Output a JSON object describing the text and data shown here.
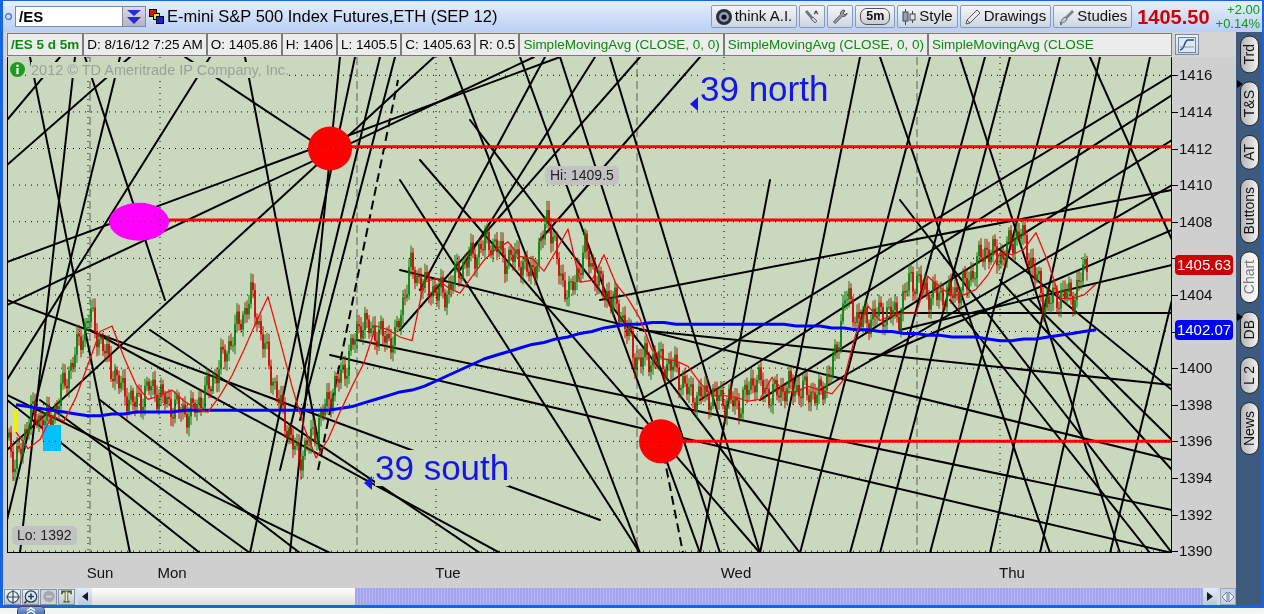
{
  "toolbar": {
    "symbol": "/ES",
    "description": "E-mini S&P 500 Index Futures,ETH (SEP 12)",
    "buttons": [
      {
        "kind": "ai",
        "label": "think A.I."
      },
      {
        "kind": "interval",
        "label": "5m"
      },
      {
        "kind": "style",
        "label": "Style"
      },
      {
        "kind": "drawings",
        "label": "Drawings"
      },
      {
        "kind": "studies",
        "label": "Studies"
      }
    ],
    "last_price": "1405.50",
    "net_change": "+2.00",
    "percent_change": "+0.14%"
  },
  "info_bar": [
    {
      "kind": "symbol",
      "text": "/ES 5 d 5m"
    },
    {
      "kind": "field",
      "text": "D: 8/16/12 7:25 AM"
    },
    {
      "kind": "field",
      "text": "O: 1405.86"
    },
    {
      "kind": "field",
      "text": "H: 1406"
    },
    {
      "kind": "field",
      "text": "L: 1405.5"
    },
    {
      "kind": "field",
      "text": "C: 1405.63"
    },
    {
      "kind": "field",
      "text": "R: 0.5"
    },
    {
      "kind": "study",
      "text": "SimpleMovingAvg (CLOSE, 0, 0)"
    },
    {
      "kind": "study",
      "text": "SimpleMovingAvg (CLOSE, 0, 0)"
    },
    {
      "kind": "study",
      "text": "SimpleMovingAvg (CLOSE"
    }
  ],
  "chart": {
    "copyright": "2012 © TD Ameritrade IP Company, Inc.",
    "annotations": [
      {
        "text": "39 north"
      },
      {
        "text": "39 south"
      }
    ],
    "hi_label": "Hi: 1409.5",
    "lo_label": "Lo: 1392",
    "price_tags": [
      {
        "text": "1405.63",
        "color": "#cc0000"
      },
      {
        "text": "1402.07",
        "color": "#0000ff"
      }
    ],
    "chart_data": {
      "type": "line",
      "grid": true,
      "categories": [
        null,
        null,
        null,
        null,
        null,
        null,
        null,
        "Sun",
        null,
        null,
        null,
        null,
        null,
        "Mon",
        null,
        null,
        null,
        null,
        null,
        null,
        null,
        null,
        null,
        null,
        null,
        null,
        null,
        null,
        null,
        null,
        null,
        null,
        null,
        null,
        null,
        null,
        "Tue",
        null,
        null,
        null,
        null,
        null,
        null,
        null,
        null,
        null,
        null,
        null,
        null,
        null,
        null,
        null,
        null,
        null,
        null,
        null,
        null,
        null,
        null,
        null,
        "Wed",
        null,
        null,
        null,
        null,
        null,
        null,
        null,
        null,
        null,
        null,
        null,
        null,
        null,
        null,
        null,
        null,
        null,
        null,
        null,
        null,
        null,
        null,
        "Thu",
        null,
        null,
        null,
        null,
        null,
        null,
        null,
        null,
        null,
        null,
        null,
        null,
        null,
        null
      ],
      "series": [
        {
          "color": "#0000ff",
          "values": [
            1398.0,
            1397.9,
            1397.8,
            1397.7,
            1397.6,
            1397.5,
            1397.4,
            1397.4,
            1397.5,
            1397.5,
            1397.6,
            1397.6,
            1397.6,
            1397.6,
            1397.7,
            1397.7,
            1397.7,
            1397.7,
            1397.7,
            1397.7,
            1397.7,
            1397.7,
            1397.7,
            1397.7,
            1397.7,
            1397.7,
            1397.7,
            1397.8,
            1397.9,
            1398.1,
            1398.3,
            1398.5,
            1398.7,
            1398.8,
            1399.0,
            1399.3,
            1399.6,
            1399.9,
            1400.2,
            1400.5,
            1400.7,
            1400.9,
            1401.1,
            1401.3,
            1401.4,
            1401.6,
            1401.7,
            1401.9,
            1402.0,
            1402.2,
            1402.3,
            1402.4,
            1402.4,
            1402.5,
            1402.5,
            1402.4,
            1402.4,
            1402.4,
            1402.4,
            1402.4,
            1402.4,
            1402.4,
            1402.4,
            1402.4,
            1402.4,
            1402.3,
            1402.3,
            1402.3,
            1402.2,
            1402.2,
            1402.1,
            1402.1,
            1402.0,
            1402.0,
            1401.9,
            1401.9,
            1401.8,
            1401.8,
            1401.7,
            1401.7,
            1401.7,
            1401.6,
            1401.5,
            1401.5,
            1401.6,
            1401.6,
            1401.7,
            1401.8,
            1401.9,
            1402.0,
            1402.1,
            null,
            null,
            null,
            null,
            null,
            null,
            null
          ]
        },
        {
          "color": "#ee1010",
          "values": [
            1396.5,
            1395.6,
            1396.1,
            1397.4,
            1397.1,
            1398.4,
            1400.2,
            1402.0,
            1402.3,
            1400.6,
            1399.1,
            1398.3,
            1398.5,
            1398.8,
            1398.2,
            1397.8,
            1397.6,
            1398.5,
            1399.6,
            1401.0,
            1402.5,
            1403.9,
            1401.5,
            1399.0,
            1396.8,
            1395.1,
            1396.1,
            1397.6,
            1399.0,
            1400.3,
            1402.3,
            1402.1,
            1401.7,
            1401.5,
            1404.7,
            1404.9,
            1404.4,
            1404.1,
            1405.0,
            1405.9,
            1406.5,
            1406.9,
            1406.1,
            1406.0,
            1405.3,
            1406.4,
            1407.6,
            1404.7,
            1404.8,
            1406.2,
            1404.6,
            1403.8,
            1402.7,
            1401.0,
            1400.5,
            1400.4,
            1400.1,
            1399.2,
            1398.5,
            1398.5,
            1398.4,
            1398.2,
            1398.3,
            1399.5,
            1398.7,
            1398.7,
            1399.0,
            1398.8,
            1398.6,
            1399.4,
            1401.9,
            1403.4,
            1402.6,
            1402.9,
            1403.0,
            1403.0,
            1405.0,
            1404.4,
            1404.0,
            1404.0,
            1404.3,
            1405.1,
            1406.3,
            1406.2,
            1406.5,
            1407.4,
            1405.8,
            1403.8,
            1403.8,
            1404.0,
            1404.6,
            null,
            null,
            null,
            null,
            null,
            null,
            null
          ]
        }
      ],
      "ylim": [
        1389.9,
        1417
      ],
      "yticks": [
        1390,
        1392,
        1394,
        1396,
        1398,
        1400,
        1404,
        1408,
        1410,
        1412,
        1414,
        1416
      ]
    }
  },
  "bottom_toolbar": {
    "tools": [
      {
        "kind": "crosshair",
        "disabled": false
      },
      {
        "kind": "zoom_in",
        "disabled": false
      },
      {
        "kind": "zoom_out",
        "disabled": true
      },
      {
        "kind": "text",
        "label": "T",
        "disabled": false
      }
    ]
  },
  "side_tabs": [
    {
      "label": "Trd",
      "selected": false
    },
    {
      "label": "T&S",
      "selected": false
    },
    {
      "label": "AT",
      "selected": false
    },
    {
      "label": "Buttons",
      "selected": false
    },
    {
      "label": "Chart",
      "selected": true
    },
    {
      "label": "DB",
      "selected": false
    },
    {
      "label": "L 2",
      "selected": false
    },
    {
      "label": "News",
      "selected": false
    }
  ]
}
